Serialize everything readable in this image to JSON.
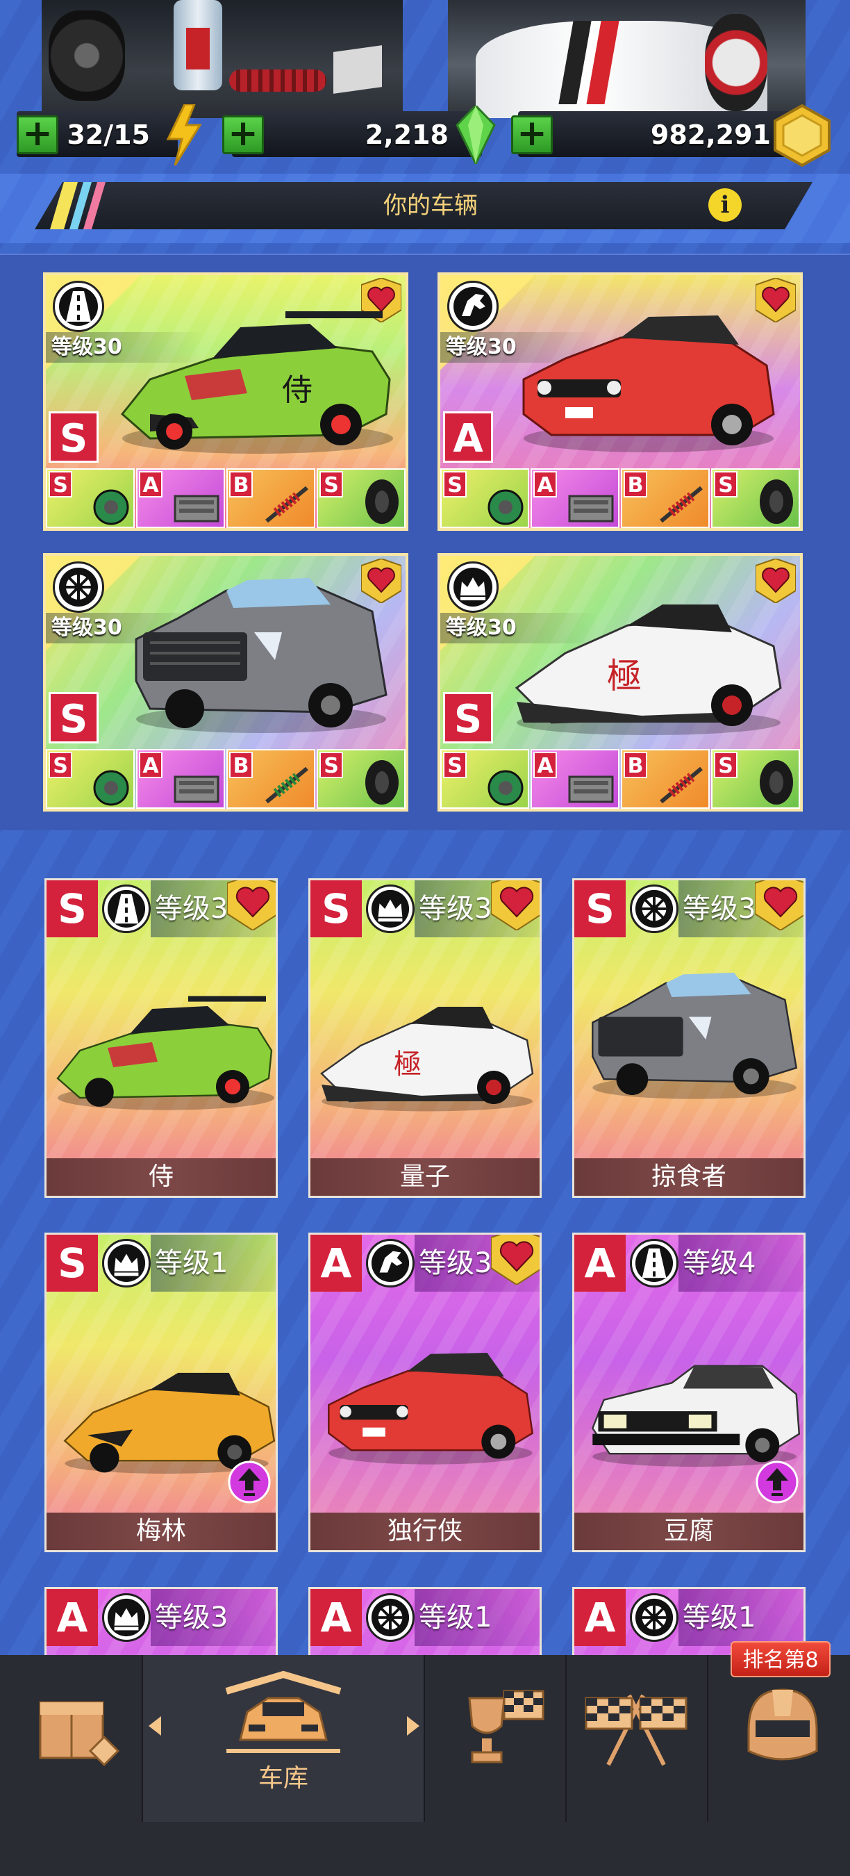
{
  "currency": {
    "fuel": "32/15",
    "gems": "2,218",
    "coins": "982,291"
  },
  "section_title": "你的车辆",
  "favorites": [
    {
      "level": "等级30",
      "rank": "S",
      "class_icon": "road-icon",
      "parts": [
        "S",
        "A",
        "B",
        "S"
      ]
    },
    {
      "level": "等级30",
      "rank": "A",
      "class_icon": "horse-icon",
      "parts": [
        "S",
        "A",
        "B",
        "S"
      ]
    },
    {
      "level": "等级30",
      "rank": "S",
      "class_icon": "wheel-icon",
      "parts": [
        "S",
        "A",
        "B",
        "S"
      ]
    },
    {
      "level": "等级30",
      "rank": "S",
      "class_icon": "crown-icon",
      "parts": [
        "S",
        "A",
        "B",
        "S"
      ]
    }
  ],
  "garage": [
    {
      "rank": "S",
      "level": "等级3",
      "name": "侍",
      "class_icon": "road-icon",
      "favorite": true
    },
    {
      "rank": "S",
      "level": "等级3",
      "name": "量子",
      "class_icon": "crown-icon",
      "favorite": true
    },
    {
      "rank": "S",
      "level": "等级3",
      "name": "掠食者",
      "class_icon": "wheel-icon",
      "favorite": true
    },
    {
      "rank": "S",
      "level": "等级1",
      "name": "梅林",
      "class_icon": "crown-icon",
      "favorite": false,
      "upgrade": true
    },
    {
      "rank": "A",
      "level": "等级3",
      "name": "独行侠",
      "class_icon": "horse-icon",
      "favorite": true
    },
    {
      "rank": "A",
      "level": "等级4",
      "name": "豆腐",
      "class_icon": "road-icon",
      "favorite": false,
      "upgrade": true
    },
    {
      "rank": "A",
      "level": "等级3",
      "class_icon": "crown-icon"
    },
    {
      "rank": "A",
      "level": "等级1",
      "class_icon": "wheel-icon"
    },
    {
      "rank": "A",
      "level": "等级1",
      "class_icon": "wheel-icon"
    }
  ],
  "nav": {
    "garage_label": "车库",
    "rank_badge": "排名第8"
  },
  "colors": {
    "rank_red": "#d4213c",
    "accent_gold": "#f5c58a",
    "header_text": "#f5d27a"
  }
}
